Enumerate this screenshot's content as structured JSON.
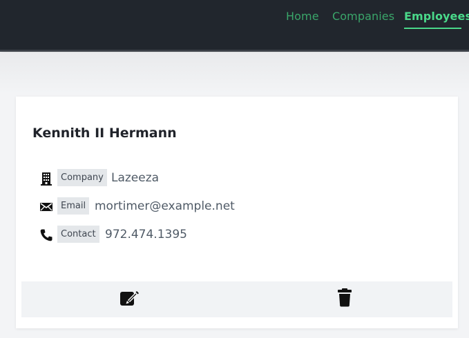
{
  "nav": {
    "items": [
      {
        "label": "Home"
      },
      {
        "label": "Companies"
      },
      {
        "label": "Employees"
      }
    ]
  },
  "employee": {
    "name": "Kennith II Hermann",
    "company": {
      "label": "Company",
      "value": "Lazeeza",
      "icon": "building-icon"
    },
    "email": {
      "label": "Email",
      "value": "mortimer@example.net",
      "icon": "envelope-icon"
    },
    "contact": {
      "label": "Contact",
      "value": "972.474.1395",
      "icon": "phone-icon"
    }
  },
  "actions": {
    "edit_icon": "edit-icon",
    "delete_icon": "trash-icon"
  },
  "colors": {
    "navbar": "#21262d",
    "nav_link": "#3aa66a",
    "nav_active": "#4ad98a",
    "page_background": "#f3f4f6",
    "card": "#ffffff",
    "badge": "#e4e7ea",
    "action_bar": "#f1f3f5"
  }
}
